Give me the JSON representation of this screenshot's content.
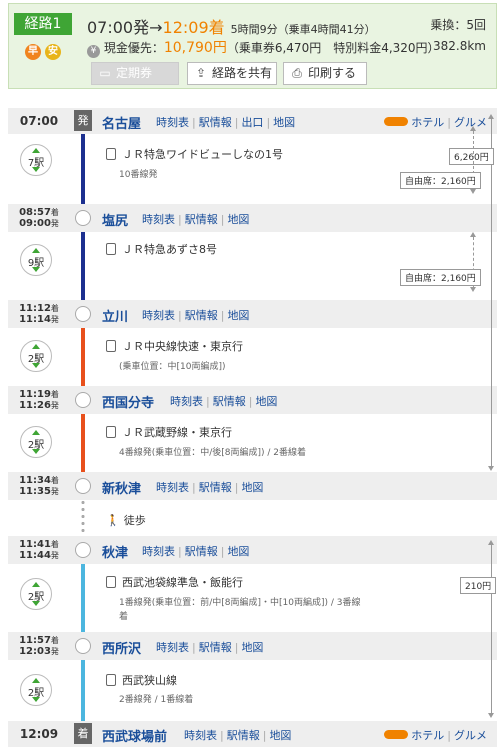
{
  "summary": {
    "route_label": "経路1",
    "icon_fast": "早",
    "icon_cheap": "安",
    "depart_time": "07:00発",
    "arrow": "→",
    "arrive_time": "12:09着",
    "duration": "5時間9分（乗車4時間41分）",
    "transfers": "乗換：5回",
    "yen_icon": "¥",
    "fare_label": "現金優先：",
    "fare_total": "10,790円",
    "fare_detail": "（乗車券6,470円　特別料金4,320円）",
    "distance": "382.8km",
    "buttons": {
      "teiki": "定期券",
      "share": "経路を共有",
      "print": "印刷する"
    }
  },
  "links": {
    "timetable": "時刻表",
    "station_info": "駅情報",
    "exit": "出口",
    "map": "地図",
    "hotel": "ホテル",
    "gourmet": "グルメ"
  },
  "badges": {
    "depart": "発",
    "arrive": "着"
  },
  "stations": [
    {
      "name": "名古屋",
      "time": "07:00"
    },
    {
      "name": "塩尻",
      "arr": "08:57",
      "dep": "09:00"
    },
    {
      "name": "立川",
      "arr": "11:12",
      "dep": "11:14"
    },
    {
      "name": "西国分寺",
      "arr": "11:19",
      "dep": "11:26"
    },
    {
      "name": "新秋津",
      "arr": "11:34",
      "dep": "11:35"
    },
    {
      "name": "秋津",
      "arr": "11:41",
      "dep": "11:44"
    },
    {
      "name": "西所沢",
      "arr": "11:57",
      "dep": "12:03"
    },
    {
      "name": "西武球場前",
      "time": "12:09"
    }
  ],
  "time_marks": {
    "arr": "着",
    "dep": "発"
  },
  "segments": [
    {
      "stops": "7駅",
      "line": "ＪＲ特急ワイドビューしなの1号",
      "sub": "10番線発",
      "color": "#1c2f8f"
    },
    {
      "stops": "9駅",
      "line": "ＪＲ特急あずさ8号",
      "sub": "",
      "color": "#1c2f8f"
    },
    {
      "stops": "2駅",
      "line": "ＪＲ中央線快速・東京行",
      "sub": "(乗車位置：中[10両編成])",
      "color": "#e8501c"
    },
    {
      "stops": "2駅",
      "line": "ＪＲ武蔵野線・東京行",
      "sub": "4番線発(乗車位置：中/後[8両編成]) / 2番線着",
      "color": "#e8501c"
    },
    {
      "walk": "徒歩"
    },
    {
      "stops": "2駅",
      "line": "西武池袋線準急・飯能行",
      "sub1": "1番線発(乗車位置：前/中[8両編成]・中[10両編成]) / 3番線",
      "sub2": "着",
      "color": "#4cb6df"
    },
    {
      "stops": "2駅",
      "line": "西武狭山線",
      "sub": "2番線発 / 1番線着",
      "color": "#4cb6df"
    }
  ],
  "fares": {
    "jr_total": "6,260円",
    "free_seat_1": "自由席：2,160円",
    "free_seat_2": "自由席：2,160円",
    "seibu_total": "210円"
  }
}
